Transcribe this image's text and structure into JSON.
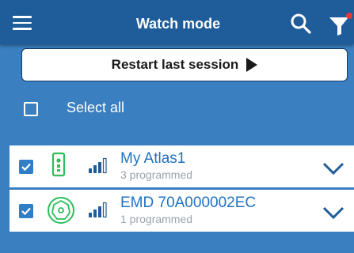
{
  "header": {
    "title": "Watch mode"
  },
  "restart_button": {
    "label": "Restart last session"
  },
  "select_all": {
    "label": "Select all"
  },
  "devices": [
    {
      "name": "My Atlas1",
      "subtitle": "3 programmed"
    },
    {
      "name": "EMD 70A000002EC",
      "subtitle": "1 programmed"
    }
  ],
  "colors": {
    "header_bg": "#1f5d9a",
    "app_bg": "#3a7fc0",
    "accent": "#1f73c4",
    "device_icon_green": "#2bbf5a",
    "filter_badge": "#e53935"
  }
}
